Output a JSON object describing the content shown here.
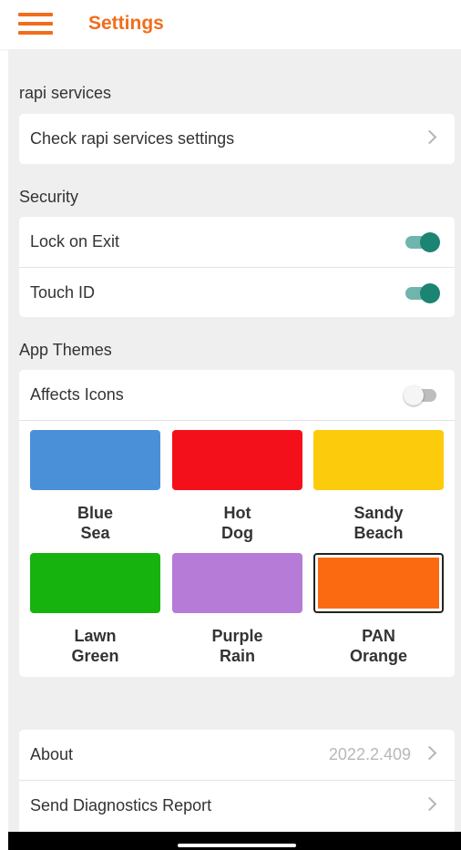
{
  "header": {
    "title": "Settings",
    "menu_icon": "hamburger-menu-icon"
  },
  "sections": {
    "rapi": {
      "label": "rapi services",
      "row_label": "Check rapi services settings"
    },
    "security": {
      "label": "Security",
      "lock_on_exit": {
        "label": "Lock on Exit",
        "enabled": true
      },
      "touch_id": {
        "label": "Touch ID",
        "enabled": true
      }
    },
    "themes": {
      "label": "App Themes",
      "affects_icons": {
        "label": "Affects Icons",
        "enabled": false
      },
      "items": [
        {
          "line1": "Blue",
          "line2": "Sea",
          "color": "#4a90d9",
          "selected": false
        },
        {
          "line1": "Hot",
          "line2": "Dog",
          "color": "#f4101b",
          "selected": false
        },
        {
          "line1": "Sandy",
          "line2": "Beach",
          "color": "#fccb0b",
          "selected": false
        },
        {
          "line1": "Lawn",
          "line2": "Green",
          "color": "#16b30f",
          "selected": false
        },
        {
          "line1": "Purple",
          "line2": "Rain",
          "color": "#b57bd6",
          "selected": false
        },
        {
          "line1": "PAN",
          "line2": "Orange",
          "color": "#fb6a11",
          "selected": true
        }
      ]
    },
    "info": {
      "about_label": "About",
      "version": "2022.2.409",
      "diagnostics_label": "Send Diagnostics Report"
    }
  },
  "colors": {
    "accent": "#f26d1b",
    "toggle_on": "#1b8473",
    "background": "#efefef"
  }
}
